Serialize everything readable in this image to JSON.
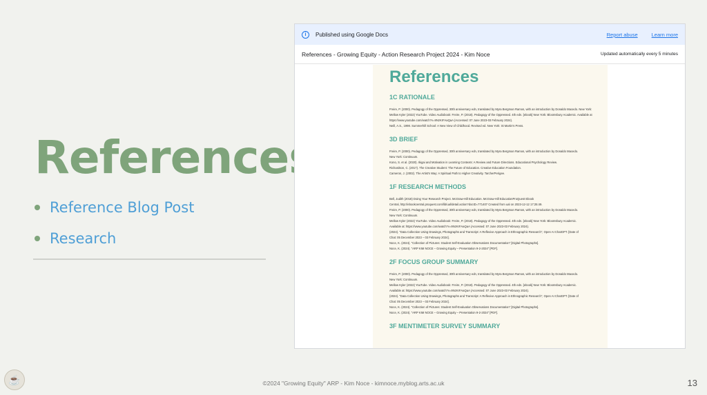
{
  "slide": {
    "title": "References",
    "bullets": [
      "Reference Blog Post",
      "Research"
    ],
    "footer": "©2024 \"Growing Equity\" ARP - Kim Noce - kimnoce.myblog.arts.ac.uk",
    "page_number": "13"
  },
  "embed": {
    "banner": {
      "text": "Published using Google Docs",
      "report_abuse": "Report abuse",
      "learn_more": "Learn more",
      "icon": "info-icon"
    },
    "doc_title": "References - Growing Equity - Action Research Project 2024 - Kim Noce",
    "updated": "Updated automatically every 5 minutes",
    "document": {
      "heading": "References",
      "sections": [
        {
          "title": "1C RATIONALE",
          "refs": [
            "Freire, P. (2000). Pedagogy of the Oppressed, 30th anniversary edn, translated by Myra Bergman Ramos, with an introduction by Donaldo Macedo. New York: Continuum.",
            "Mellow Kyler (2022) YouTube. Video Audiobook: Freire, P. (2018). Pedagogy of the Oppressed. 4th edn. [ebook] New York: Bloomsbury Academic. Available at:",
            "https://www.youtube.com/watch?v=9NzKrFAaQaA (Accessed: 07 June 2023-03 February 2024).",
            "Neill, A.S., 1998. Summerhill School: A New View of Childhood. Revised ed. New York: St Martin's Press."
          ]
        },
        {
          "title": "3D BRIEF",
          "refs": [
            "Freire, P. (2000). Pedagogy of the Oppressed, 30th anniversary edn, translated by Myra Bergman Ramos, with an introduction by Donaldo Macedo.",
            "New York: Continuum.",
            "Kono, S. et al. (2020). Ikigai and Motivation in Learning Contexts: A Review and Future Directions. Educational Psychology Review.",
            "Richardson, C. (2017). The Creative Student: The Future of Education. Creative Education Foundation.",
            "Cameron, J. (2002). The Artist's Way: A Spiritual Path to Higher Creativity. TarcherPerigee."
          ]
        },
        {
          "title": "1F RESEARCH METHODS",
          "refs": [
            "Bell, Judith (2018) Doing Your Research Project. McGraw-Hill Education. McGraw-Hill EducationProQuest Ebook",
            "Central, http://ebookcentral.proquest.com/lib/ual/detail.action?docID=771407 Created from ual on 2023-12-12 17:25:49.",
            "Freire, P. (2000). Pedagogy of the Oppressed, 30th anniversary edn, translated by Myra Bergman Ramos, with an introduction by Donaldo Macedo.",
            "New York: Continuum.",
            "Mellow Kyler (2022) YouTube. Video Audiobook: Freire, P. (2018). Pedagogy of the Oppressed. 4th edn. [ebook] New York: Bloomsbury Academic.",
            "Available at: https://www.youtube.com/watch?v=9NzKrFAaQaA (Accessed: 07 June 2023-03 February 2024).",
            "(2024). \"Data Collection Using Drawings, Photographs and Transcript: A Reflexive Approach in Ethnographic Research\", Open AI ChatGPT. [Date of",
            "Chat: 05 December 2023 – 03 February 2024].",
            "Noce, K. (2024). \"Collection of Pictures: Student Self-Evaluation Observations Documentation\" [Digital Photographs].",
            "Noce, K. (2024). \"ARP KIM NOCE – Growing Equity – Presentation 9-2-2024\" [PDF]."
          ]
        },
        {
          "title": "2F FOCUS GROUP SUMMARY",
          "refs": [
            "Freire, P. (2000). Pedagogy of the Oppressed, 30th anniversary edn, translated by Myra Bergman Ramos, with an introduction by Donaldo Macedo.",
            "New York: Continuum.",
            "Mellow Kyler (2022) YouTube. Video Audiobook: Freire, P. (2018). Pedagogy of the Oppressed. 4th edn. [ebook] New York: Bloomsbury Academic.",
            "Available at: https://www.youtube.com/watch?v=9NzKrFAaQaA (Accessed: 07 June 2023-03 February 2024).",
            "(2024). \"Data Collection Using Drawings, Photographs and Transcript: A Reflexive Approach in Ethnographic Research\", Open AI ChatGPT. [Date of",
            "Chat: 05 December 2023 – 03 February 2024].",
            "Noce, K. (2024). \"Collection of Pictures: Student Self-Evaluation Observations Documentation\" [Digital Photographs].",
            "Noce, K. (2024). \"ARP KIM NOCE – Growing Equity – Presentation 9-2-2024\" [PDF]."
          ]
        },
        {
          "title": "3F MENTIMETER SURVEY SUMMARY",
          "refs": []
        }
      ]
    }
  },
  "colors": {
    "title_green": "#7fa47b",
    "link_blue": "#4f9fd6",
    "doc_teal": "#4fa99a",
    "banner_bg": "#e8f0fe"
  }
}
